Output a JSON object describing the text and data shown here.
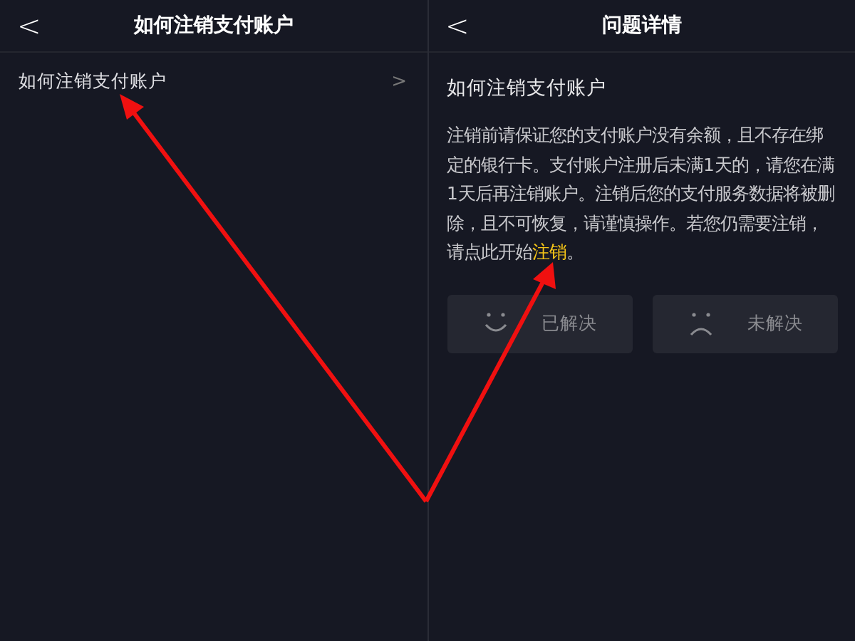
{
  "left_screen": {
    "header": {
      "back": "<",
      "title": "如何注销支付账户"
    },
    "items": [
      {
        "label": "如何注销支付账户",
        "chevron": ">"
      }
    ]
  },
  "right_screen": {
    "header": {
      "back": "<",
      "title": "问题详情"
    },
    "question": "如何注销支付账户",
    "answer": {
      "text": "注销前请保证您的支付账户没有余额，且不存在绑定的银行卡。支付账户注册后未满1天的，请您在满1天后再注销账户。注销后您的支付服务数据将被删除，且不可恢复，请谨慎操作。若您仍需要注销，请点此开始",
      "link": "注销",
      "end": "。"
    },
    "feedback": [
      {
        "kind": "smile",
        "label": "已解决"
      },
      {
        "kind": "frown",
        "label": "未解决"
      }
    ]
  }
}
